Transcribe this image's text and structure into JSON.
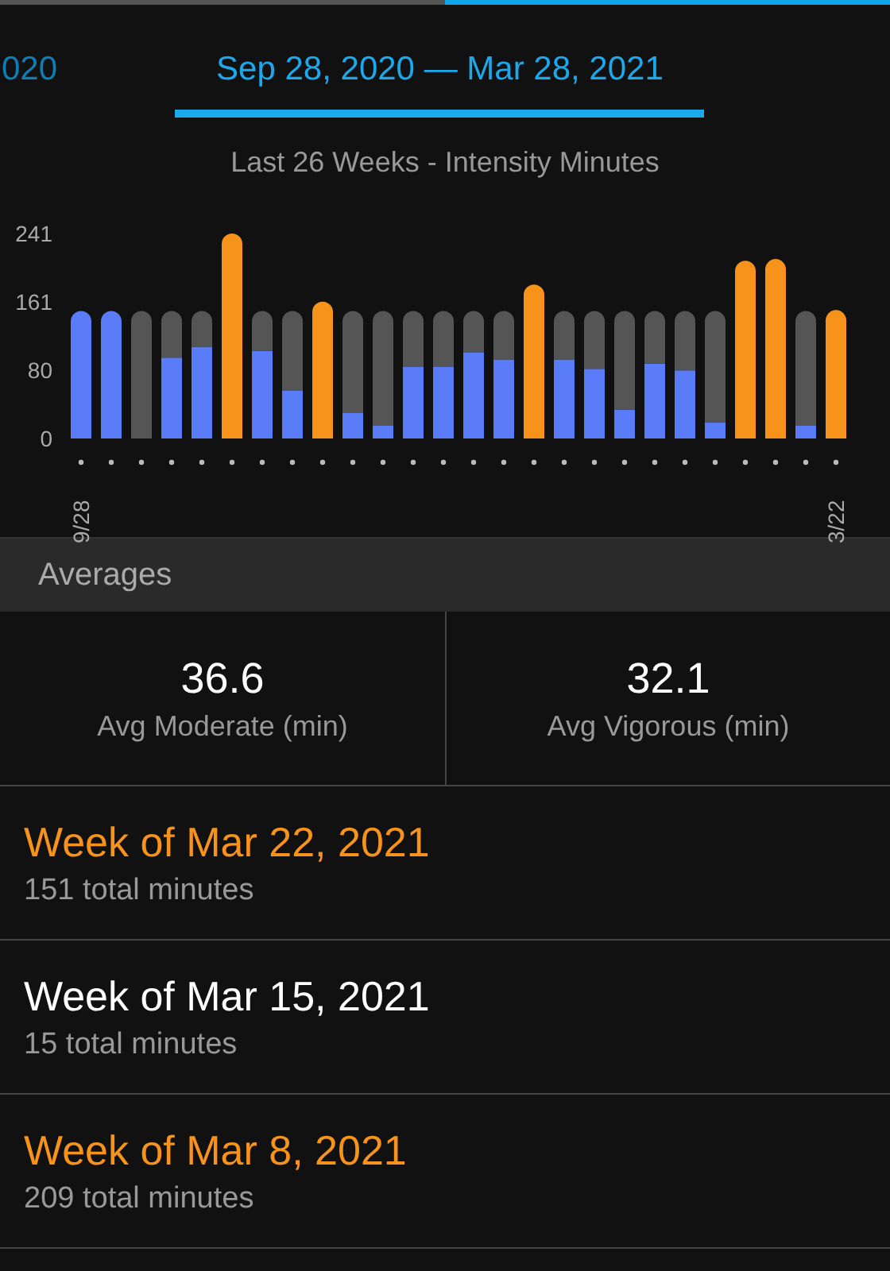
{
  "tabs": [
    {
      "label": "020",
      "selected": false
    },
    {
      "label": "Sep 28, 2020 — Mar 28, 2021",
      "selected": true
    }
  ],
  "chart": {
    "chart_data": {
      "type": "bar",
      "title": "Last 26 Weeks - Intensity Minutes",
      "stacked": true,
      "categories": [
        "9/28",
        null,
        null,
        null,
        null,
        null,
        null,
        null,
        null,
        null,
        null,
        null,
        null,
        null,
        null,
        null,
        null,
        null,
        null,
        null,
        null,
        null,
        null,
        null,
        null,
        "3/22"
      ],
      "series": [
        {
          "color": "#5a7cf8",
          "values": [
            150,
            150,
            0,
            95,
            108,
            null,
            103,
            56,
            null,
            30,
            15,
            84,
            84,
            101,
            93,
            null,
            93,
            82,
            34,
            88,
            80,
            19,
            null,
            null,
            15,
            null
          ]
        },
        {
          "color": "#555555",
          "values": [
            0,
            0,
            150,
            55,
            42,
            null,
            47,
            94,
            null,
            120,
            135,
            66,
            66,
            49,
            57,
            null,
            57,
            68,
            116,
            62,
            70,
            131,
            null,
            null,
            135,
            null
          ]
        },
        {
          "color": "#f7931a",
          "values": [
            null,
            null,
            null,
            null,
            null,
            241,
            null,
            null,
            161,
            null,
            null,
            null,
            null,
            null,
            null,
            181,
            null,
            null,
            null,
            null,
            null,
            null,
            209,
            211,
            null,
            151
          ]
        }
      ],
      "ylim": [
        0,
        241
      ],
      "yticks": [
        0,
        80,
        161,
        241
      ]
    }
  },
  "averages": {
    "title": "Averages",
    "items": [
      {
        "value": "36.6",
        "label": "Avg Moderate (min)"
      },
      {
        "value": "32.1",
        "label": "Avg Vigorous (min)"
      }
    ]
  },
  "weeks": [
    {
      "title": "Week of Mar 22, 2021",
      "total": "151 total minutes",
      "goal_met": true
    },
    {
      "title": "Week of Mar 15, 2021",
      "total": "15 total minutes",
      "goal_met": false
    },
    {
      "title": "Week of Mar 8, 2021",
      "total": "209 total minutes",
      "goal_met": true
    }
  ]
}
